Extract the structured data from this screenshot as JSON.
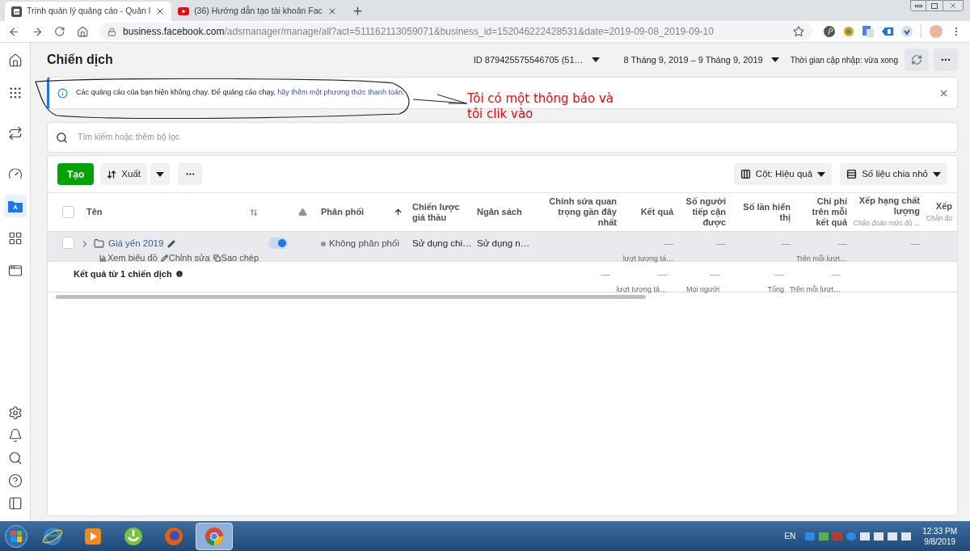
{
  "browser": {
    "tabs": [
      {
        "kind": "ads",
        "title": "Trình quản lý quảng cáo - Quản l",
        "selected": true
      },
      {
        "kind": "video",
        "title": "(36) Hướng dẫn tạo tài khoản Fac",
        "selected": false
      }
    ],
    "url": {
      "host": "business.facebook.com",
      "path": "/adsmanager/manage/all?act=511162113059071&business_id=152046222428531&date=2019-09-08_2019-09-10"
    }
  },
  "sidebar": {
    "items": [
      {
        "kind": "home",
        "selected": false
      },
      {
        "kind": "apps",
        "selected": false
      },
      {
        "kind": "swap",
        "selected": false
      },
      {
        "kind": "gauge",
        "selected": false
      },
      {
        "kind": "folder",
        "selected": true
      },
      {
        "kind": "tiles",
        "selected": false
      },
      {
        "kind": "window",
        "selected": false
      }
    ],
    "bottom_items": [
      {
        "kind": "settings",
        "selected": false
      },
      {
        "kind": "bell",
        "selected": false
      },
      {
        "kind": "search",
        "selected": false
      },
      {
        "kind": "help",
        "selected": false
      },
      {
        "kind": "panels",
        "selected": false
      }
    ]
  },
  "header": {
    "title": "Chiến dịch",
    "account": "ID 879425575546705 (51…",
    "date_range": "8 Tháng 9, 2019 – 9 Tháng 9, 2019",
    "updated": "Thời gian cập nhập: vừa xong"
  },
  "notice": {
    "text": "Các quảng cáo của bạn hiện không chạy. Để quảng cáo chạy,",
    "link": "hãy thêm một phương thức thanh toán."
  },
  "annotation": {
    "text": "Tôi có một thông báo và tôi clik vào"
  },
  "search": {
    "placeholder": "Tìm kiếm hoặc thêm bộ lọc"
  },
  "toolbar": {
    "create": "Tạo",
    "export": "Xuất",
    "columns": "Cột: Hiệu quả",
    "breakdown": "Số liệu chia nhỏ"
  },
  "table": {
    "header_checked": false,
    "columns": [
      {
        "label": "Tên"
      },
      {
        "label": "Phân phối"
      },
      {
        "label": "Chiến lược giá thầu"
      },
      {
        "label": "Ngân sách"
      },
      {
        "label": "Chỉnh sửa quan trọng gần đây nhất"
      },
      {
        "label": "Kết quả"
      },
      {
        "label": "Số người tiếp cận được"
      },
      {
        "label": "Số lần hiển thị"
      },
      {
        "label": "Chi phí trên mỗi kết quả"
      },
      {
        "label": "Xếp hạng chất lượng",
        "sublabel": "Chẩn đoán mức độ ..."
      },
      {
        "label": "Xếp",
        "sublabel": "Chẩn đo"
      }
    ],
    "rows": [
      {
        "checked": false,
        "on": true,
        "cells": [
          {
            "value": "Giá yến 2019",
            "actions": [
              "Xem biểu đồ",
              "Chỉnh sửa",
              "Sao chép"
            ]
          },
          {
            "value": "Không phân phối"
          },
          {
            "value": "Sử dụng chi…"
          },
          {
            "value": "Sử dụng n…"
          },
          {},
          {
            "value": "—",
            "note": "lượt tương tá…"
          },
          {
            "value": "—"
          },
          {
            "value": "—"
          },
          {
            "value": "—",
            "note": "Trên mỗi lượt…"
          },
          {
            "value": "—"
          },
          {}
        ]
      }
    ],
    "summary": {
      "cells": [
        {
          "value": "Kết quả từ 1 chiến dịch"
        },
        {},
        {},
        {},
        {
          "value": "—"
        },
        {
          "value": "—",
          "note": "lượt tương tá…"
        },
        {
          "value": "—",
          "note": "Mọi người"
        },
        {
          "value": "—",
          "note": "Tổng"
        },
        {
          "value": "—",
          "note": "Trên mỗi lượt…"
        },
        {},
        {}
      ]
    }
  },
  "taskbar": {
    "items": [
      {
        "kind": "ie",
        "selected": false
      },
      {
        "kind": "media",
        "selected": false
      },
      {
        "kind": "green",
        "selected": false
      },
      {
        "kind": "firefox",
        "selected": false
      },
      {
        "kind": "chrome",
        "selected": true
      }
    ],
    "language": "EN",
    "time": "12:33 PM",
    "date": "9/8/2019"
  }
}
